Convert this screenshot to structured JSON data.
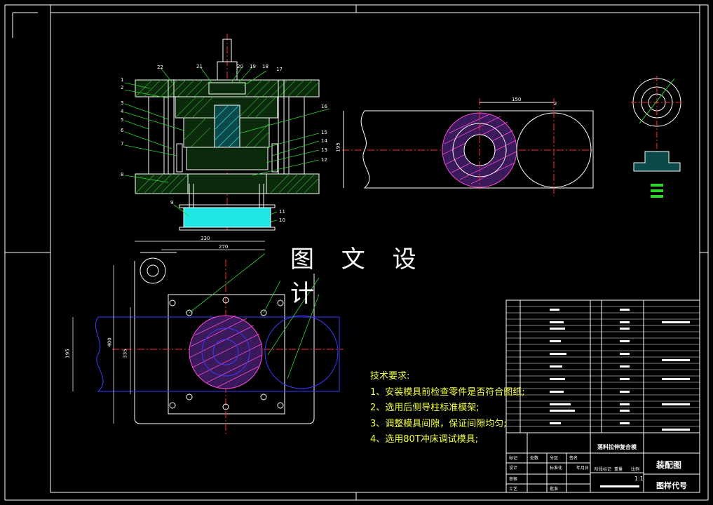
{
  "watermark": "图 文 设 计",
  "technical_requirements": {
    "title": "技术要求:",
    "items": [
      "1、安装模具前检查零件是否符合图纸;",
      "2、选用后侧导柱标准模架;",
      "3、调整模具间隙，保证间隙均匀;",
      "4、选用80T冲床调试模具;"
    ]
  },
  "title_block": {
    "product_name": "落料拉伸复合模",
    "drawing_type": "装配图",
    "drawing_code": "图样代号",
    "scale": "1:1",
    "row_labels": [
      "标记",
      "处数",
      "分区",
      "签名",
      "年月日",
      "设计",
      "标准化",
      "审核",
      "工艺",
      "批准",
      "阶段标记",
      "重量",
      "比例"
    ]
  },
  "section_view": {
    "part_numbers": [
      "1",
      "2",
      "3",
      "4",
      "5",
      "6",
      "7",
      "8",
      "9",
      "10",
      "11",
      "12",
      "13",
      "14",
      "15",
      "16",
      "17",
      "18",
      "19",
      "20",
      "21",
      "22"
    ]
  },
  "dimensions": {
    "plan_width": "330",
    "plan_inner_width": "270",
    "plan_height": "400",
    "plan_inner_height": "335",
    "strip_width": "195",
    "pitch": "150",
    "strip_gap": "2"
  }
}
